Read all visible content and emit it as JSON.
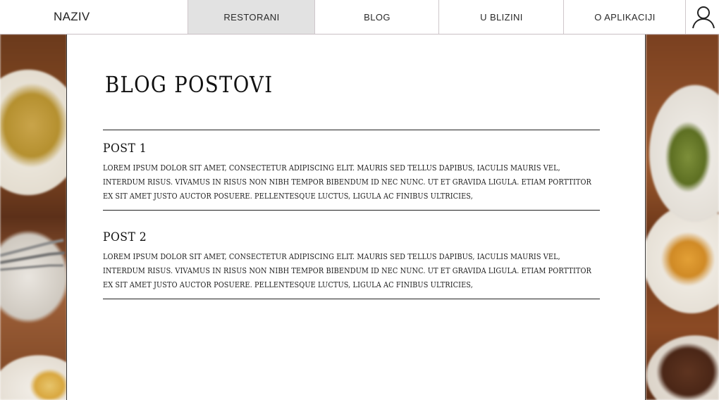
{
  "header": {
    "brand": "NAZIV",
    "nav": [
      {
        "label": "RESTORANI",
        "active": true
      },
      {
        "label": "BLOG",
        "active": false
      },
      {
        "label": "U BLIZINI",
        "active": false
      },
      {
        "label": "O APLIKACIJI",
        "active": false
      }
    ],
    "profile_icon": "user-icon"
  },
  "main": {
    "title": "BLOG POSTOVI",
    "posts": [
      {
        "title": "POST 1",
        "body": "LOREM IPSUM DOLOR SIT AMET, CONSECTETUR ADIPISCING ELIT. MAURIS SED TELLUS DAPIBUS, IACULIS MAURIS VEL, INTERDUM RISUS. VIVAMUS IN RISUS NON NIBH TEMPOR BIBENDUM ID NEC NUNC. UT ET GRAVIDA LIGULA. ETIAM PORTTITOR EX SIT AMET JUSTO AUCTOR POSUERE. PELLENTESQUE LUCTUS, LIGULA AC FINIBUS ULTRICIES,"
      },
      {
        "title": "POST 2",
        "body": "LOREM IPSUM DOLOR SIT AMET, CONSECTETUR ADIPISCING ELIT. MAURIS SED TELLUS DAPIBUS, IACULIS MAURIS VEL, INTERDUM RISUS. VIVAMUS IN RISUS NON NIBH TEMPOR BIBENDUM ID NEC NUNC. UT ET GRAVIDA LIGULA. ETIAM PORTTITOR EX SIT AMET JUSTO AUCTOR POSUERE. PELLENTESQUE LUCTUS, LIGULA AC FINIBUS ULTRICIES,"
      }
    ]
  },
  "colors": {
    "active_tab_bg": "#e2e2e2",
    "text": "#111111",
    "divider": "#222222"
  }
}
